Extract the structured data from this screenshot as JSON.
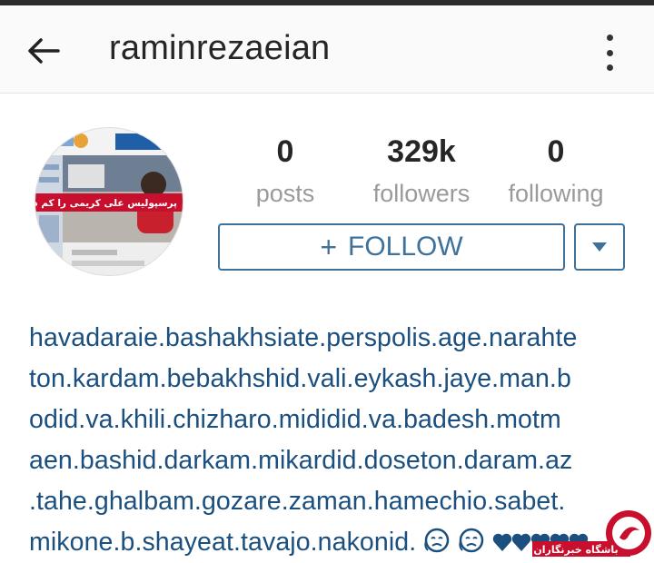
{
  "header": {
    "username": "raminrezaeian",
    "back_icon": "arrow-left-icon",
    "menu_icon": "more-vertical-icon"
  },
  "profile": {
    "avatar_headline": "پرسپولیس علی کریمی را کم دارد",
    "stats": [
      {
        "value": "0",
        "label": "posts"
      },
      {
        "value": "329k",
        "label": "followers"
      },
      {
        "value": "0",
        "label": "following"
      }
    ],
    "follow_label": "FOLLOW",
    "follow_icon": "plus-icon",
    "dropdown_icon": "caret-down-icon"
  },
  "bio": {
    "lines": [
      "havadaraie.bashakhsiate.perspolis.age.narahte",
      "ton.kardam.bebakhshid.vali.eykash.jaye.man.b",
      "odid.va.khili.chizharo.mididid.va.badesh.motm",
      "aen.bashid.darkam.mikardid.doseton.daram.az",
      ".tahe.ghalbam.gozare.zaman.hamechio.sabet.",
      "mikone.b.shayeat.tavajo.nakonid."
    ]
  },
  "watermark": {
    "text": "باشگاه خبرنگاران"
  },
  "colors": {
    "accent": "#3f729b",
    "bio_text": "#1a4f7f",
    "watermark": "#c8102e"
  }
}
